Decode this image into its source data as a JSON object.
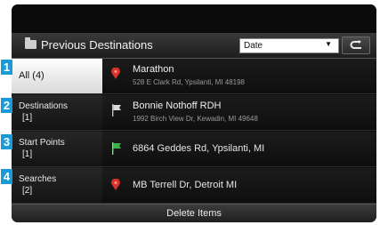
{
  "header": {
    "title": "Previous Destinations",
    "sort_value": "Date",
    "back_icon": "back-arrow-icon"
  },
  "tabs": [
    {
      "label": "All (4)",
      "count": "",
      "badge": "1"
    },
    {
      "label": "Destinations",
      "count": "[1]",
      "badge": "2"
    },
    {
      "label": "Start Points",
      "count": "[1]",
      "badge": "3"
    },
    {
      "label": "Searches",
      "count": "[2]",
      "badge": "4"
    }
  ],
  "items": [
    {
      "name": "Marathon",
      "address": "528 E Clark Rd, Ypsilanti, MI 48198",
      "icon": "red-pin-icon"
    },
    {
      "name": "Bonnie Nothoff RDH",
      "address": "1992 Birch View Dr, Kewadin, MI 49648",
      "icon": "white-flag-icon"
    },
    {
      "name": "6864 Geddes Rd, Ypsilanti, MI",
      "address": "",
      "icon": "green-flag-icon"
    },
    {
      "name": "MB Terrell Dr, Detroit MI",
      "address": "",
      "icon": "red-pin-icon"
    }
  ],
  "footer": {
    "delete_label": "Delete Items"
  },
  "colors": {
    "accent_badge": "#1a9bd8",
    "active_tab_bg": "#ffffff",
    "pin_red": "#d8322b",
    "flag_green": "#3bb34a"
  }
}
